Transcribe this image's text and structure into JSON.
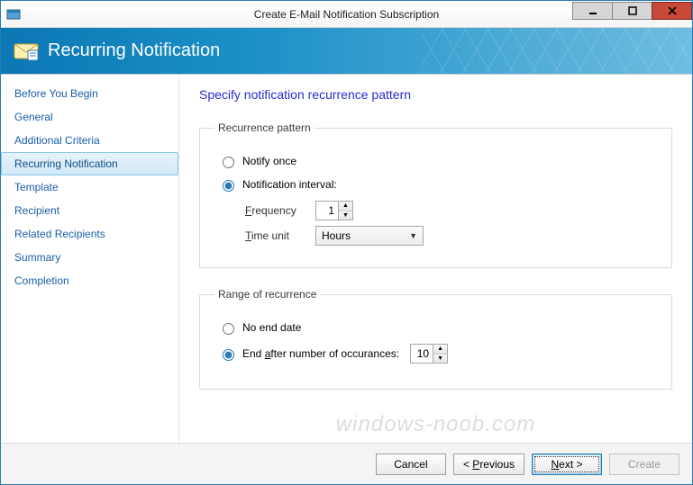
{
  "window": {
    "title": "Create E-Mail Notification Subscription"
  },
  "header": {
    "title": "Recurring Notification"
  },
  "sidebar": {
    "items": [
      {
        "label": "Before You Begin",
        "active": false
      },
      {
        "label": "General",
        "active": false
      },
      {
        "label": "Additional Criteria",
        "active": false
      },
      {
        "label": "Recurring Notification",
        "active": true
      },
      {
        "label": "Template",
        "active": false
      },
      {
        "label": "Recipient",
        "active": false
      },
      {
        "label": "Related Recipients",
        "active": false
      },
      {
        "label": "Summary",
        "active": false
      },
      {
        "label": "Completion",
        "active": false
      }
    ]
  },
  "content": {
    "heading": "Specify notification recurrence pattern",
    "recurrence": {
      "legend": "Recurrence pattern",
      "notify_once_label": "Notify once",
      "interval_label": "Notification interval:",
      "selected": "interval",
      "frequency_label": "Frequency",
      "frequency_value": "1",
      "timeunit_label": "Time unit",
      "timeunit_value": "Hours"
    },
    "range": {
      "legend": "Range of recurrence",
      "noend_label": "No end date",
      "endafter_label": "End after number of occurances:",
      "selected": "endafter",
      "occurrences_value": "10"
    }
  },
  "footer": {
    "cancel": "Cancel",
    "previous": "< Previous",
    "next": "Next >",
    "create": "Create"
  },
  "watermark": "windows-noob.com"
}
